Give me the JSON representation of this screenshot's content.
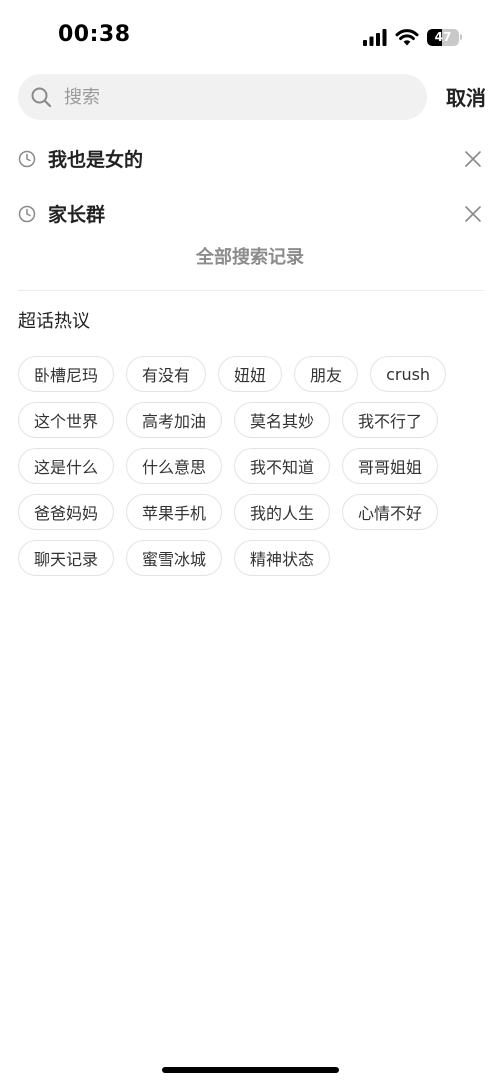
{
  "status_bar": {
    "time": "00:38",
    "battery_level": "47",
    "battery_fraction": 0.47,
    "icons": [
      "cellular-signal-icon",
      "wifi-icon",
      "battery-icon"
    ]
  },
  "search": {
    "placeholder": "搜索",
    "value": "",
    "cancel_label": "取消"
  },
  "history": {
    "items": [
      {
        "label": "我也是女的"
      },
      {
        "label": "家长群"
      }
    ],
    "all_label": "全部搜索记录"
  },
  "hot_topics": {
    "title": "超话热议",
    "tags": [
      "卧槽尼玛",
      "有没有",
      "妞妞",
      "朋友",
      "crush",
      "这个世界",
      "高考加油",
      "莫名其妙",
      "我不行了",
      "这是什么",
      "什么意思",
      "我不知道",
      "哥哥姐姐",
      "爸爸妈妈",
      "苹果手机",
      "我的人生",
      "心情不好",
      "聊天记录",
      "蜜雪冰城",
      "精神状态"
    ]
  },
  "colors": {
    "background": "#ffffff",
    "search_bg": "#f1f1f1",
    "muted_text": "#8c8c8c",
    "tag_border": "#e3e3e3"
  }
}
